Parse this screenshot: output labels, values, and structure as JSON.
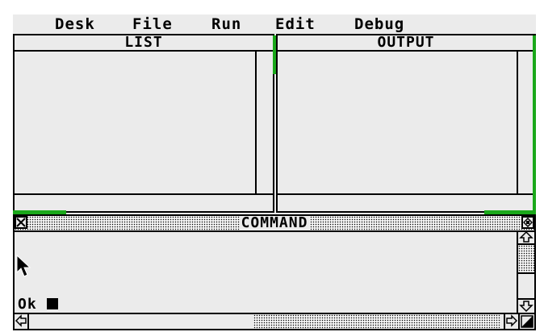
{
  "menu": {
    "items": [
      "Desk",
      "File",
      "Run",
      "Edit",
      "Debug"
    ]
  },
  "windows": {
    "list": {
      "title": "LIST"
    },
    "output": {
      "title": "OUTPUT"
    },
    "command": {
      "title": "COMMAND",
      "prompt": "Ok"
    }
  },
  "colors": {
    "desktop": "#ebebeb",
    "accent_green": "#1aa81a",
    "ink": "#000000"
  },
  "icons": {
    "close": "close-box-icon",
    "fuller": "fuller-box-icon",
    "up": "arrow-up-icon",
    "down": "arrow-down-icon",
    "left": "arrow-left-icon",
    "right": "arrow-right-icon",
    "size": "size-box-icon",
    "pointer": "mouse-pointer-icon"
  }
}
